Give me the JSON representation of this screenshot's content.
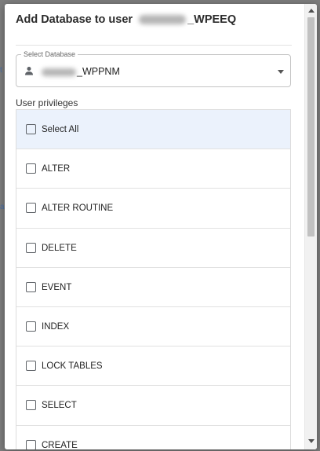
{
  "dialog": {
    "title_prefix": "Add Database to user ",
    "title_suffix": "_WPEEQ"
  },
  "select": {
    "label": "Select Database",
    "value_suffix": "_WPPNM",
    "icon": "person-icon"
  },
  "privileges": {
    "label": "User privileges",
    "items": [
      {
        "label": "Select All",
        "checked": false
      },
      {
        "label": "ALTER",
        "checked": false
      },
      {
        "label": "ALTER ROUTINE",
        "checked": false
      },
      {
        "label": "DELETE",
        "checked": false
      },
      {
        "label": "EVENT",
        "checked": false
      },
      {
        "label": "INDEX",
        "checked": false
      },
      {
        "label": "LOCK TABLES",
        "checked": false
      },
      {
        "label": "SELECT",
        "checked": false
      },
      {
        "label": "CREATE",
        "checked": false
      }
    ]
  },
  "backdrop": {
    "peek_text_1": "t",
    "peek_text_2": "a"
  },
  "colors": {
    "highlight_row": "#ebf2fc",
    "overlay": "#7d7d7d",
    "checkbox_border": "#5f6368"
  }
}
